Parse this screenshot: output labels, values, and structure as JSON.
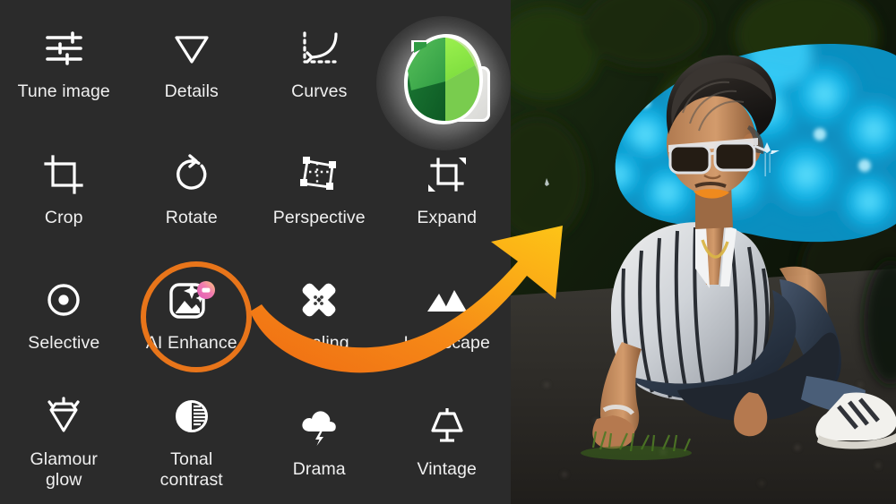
{
  "app": {
    "name": "Snapseed",
    "panel_background": "#2b2b2b",
    "highlight_color": "#e8751a",
    "arrow_color_start": "#f26b14",
    "arrow_color_end": "#fcbf16"
  },
  "tools": [
    {
      "label": "Tune image",
      "icon": "tune-image-icon",
      "highlighted": false
    },
    {
      "label": "Details",
      "icon": "details-icon",
      "highlighted": false
    },
    {
      "label": "Curves",
      "icon": "curves-icon",
      "highlighted": false
    },
    {
      "label": "",
      "icon": "snapseed-logo-icon",
      "highlighted": false
    },
    {
      "label": "Crop",
      "icon": "crop-icon",
      "highlighted": false
    },
    {
      "label": "Rotate",
      "icon": "rotate-icon",
      "highlighted": false
    },
    {
      "label": "Perspective",
      "icon": "perspective-icon",
      "highlighted": false
    },
    {
      "label": "Expand",
      "icon": "expand-icon",
      "highlighted": false
    },
    {
      "label": "Selective",
      "icon": "selective-icon",
      "highlighted": false
    },
    {
      "label": "AI Enhance",
      "icon": "ai-enhance-icon",
      "highlighted": true
    },
    {
      "label": "Healing",
      "icon": "healing-icon",
      "highlighted": false
    },
    {
      "label": "Landscape",
      "icon": "landscape-icon",
      "highlighted": false
    },
    {
      "label": "Glamour\nglow",
      "icon": "glamour-glow-icon",
      "highlighted": false
    },
    {
      "label": "Tonal\ncontrast",
      "icon": "tonal-contrast-icon",
      "highlighted": false
    },
    {
      "label": "Drama",
      "icon": "drama-icon",
      "highlighted": false
    },
    {
      "label": "Vintage",
      "icon": "vintage-icon",
      "highlighted": false
    }
  ],
  "annotation": {
    "ring_target": "AI Enhance",
    "arrow_name": "curved-orange-arrow",
    "arrow_from": "AI Enhance",
    "arrow_to": "photo-preview"
  },
  "photo": {
    "description": "Young man wearing sunglasses sitting on a gravel path, black-and-white striped shirt, blue jeans, white sneakers, bright blue bokeh light background",
    "backdrop_color": "#0bb6e8",
    "foliage_color": "#14220e"
  }
}
